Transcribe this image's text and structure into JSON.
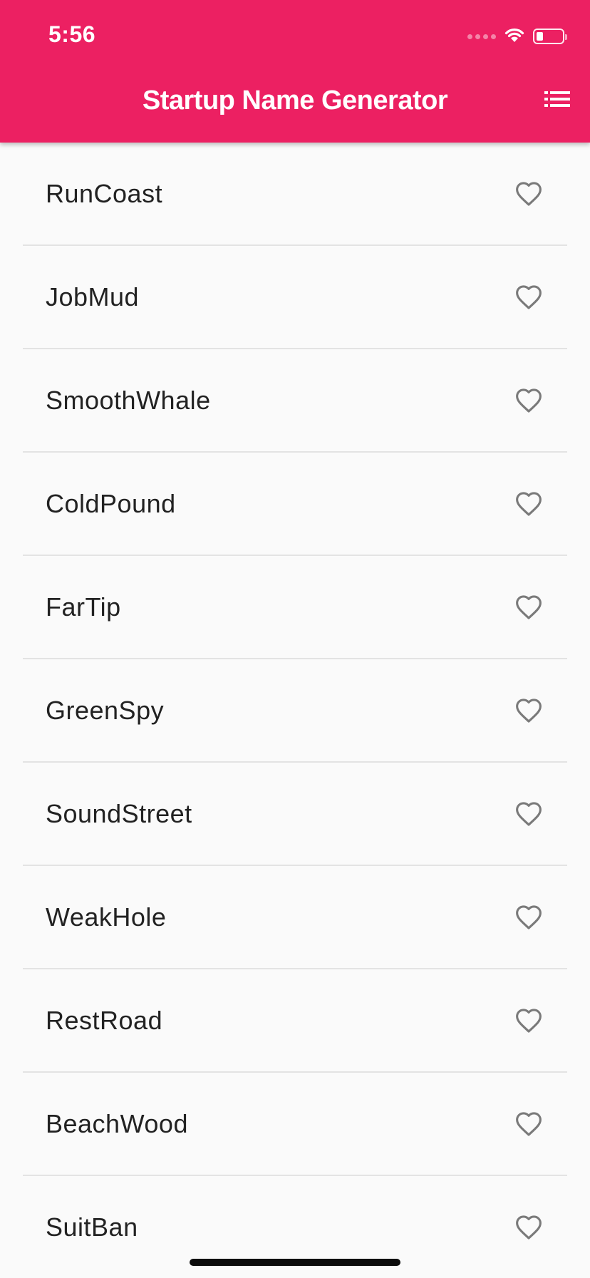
{
  "status_bar": {
    "time": "5:56",
    "battery_level": 0.25
  },
  "app_bar": {
    "title": "Startup Name Generator",
    "action_icon": "list-icon",
    "background_color": "#ec2062"
  },
  "list": {
    "items": [
      {
        "label": "RunCoast",
        "favorited": false
      },
      {
        "label": "JobMud",
        "favorited": false
      },
      {
        "label": "SmoothWhale",
        "favorited": false
      },
      {
        "label": "ColdPound",
        "favorited": false
      },
      {
        "label": "FarTip",
        "favorited": false
      },
      {
        "label": "GreenSpy",
        "favorited": false
      },
      {
        "label": "SoundStreet",
        "favorited": false
      },
      {
        "label": "WeakHole",
        "favorited": false
      },
      {
        "label": "RestRoad",
        "favorited": false
      },
      {
        "label": "BeachWood",
        "favorited": false
      },
      {
        "label": "SuitBan",
        "favorited": false
      }
    ],
    "favorite_icon": "heart-outline-icon"
  }
}
